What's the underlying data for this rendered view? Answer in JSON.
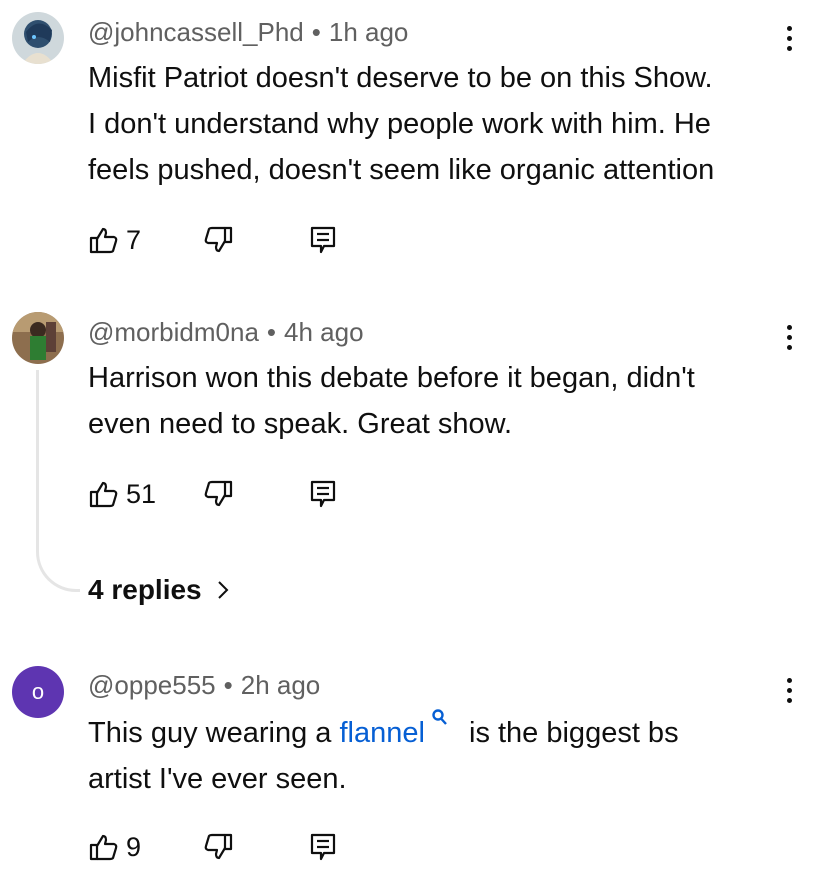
{
  "comments": [
    {
      "handle": "@johncassell_Phd",
      "time": "1h ago",
      "text_lines": [
        "Misfit Patriot doesn't deserve to be on this Show.",
        "I don't understand why people work with him. He",
        "feels pushed, doesn't seem like organic attention"
      ],
      "likes": "7",
      "avatar": "anime-character-avatar"
    },
    {
      "handle": "@morbidm0na",
      "time": "4h ago",
      "text_lines": [
        "Harrison won this debate before it began, didn't",
        "even need to speak. Great show."
      ],
      "likes": "51",
      "replies_label": "4 replies",
      "avatar": "photo-avatar"
    },
    {
      "handle": "@oppe555",
      "time": "2h ago",
      "text_before_link": "This guy wearing a ",
      "link_text": "flannel",
      "text_after_link": " is the biggest bs",
      "text_line2": "artist I've ever seen.",
      "likes": "9",
      "avatar_letter": "o",
      "avatar_color": "#5e35b1"
    }
  ],
  "separator": "•",
  "icons": {
    "like": "thumbs-up-icon",
    "dislike": "thumbs-down-icon",
    "reply": "reply-comment-icon",
    "more": "more-vertical-icon",
    "chevron": "chevron-right-icon",
    "search": "search-icon"
  },
  "colors": {
    "link": "#065fd4",
    "meta": "#606060",
    "letter_avatar": "#5e35b1"
  }
}
